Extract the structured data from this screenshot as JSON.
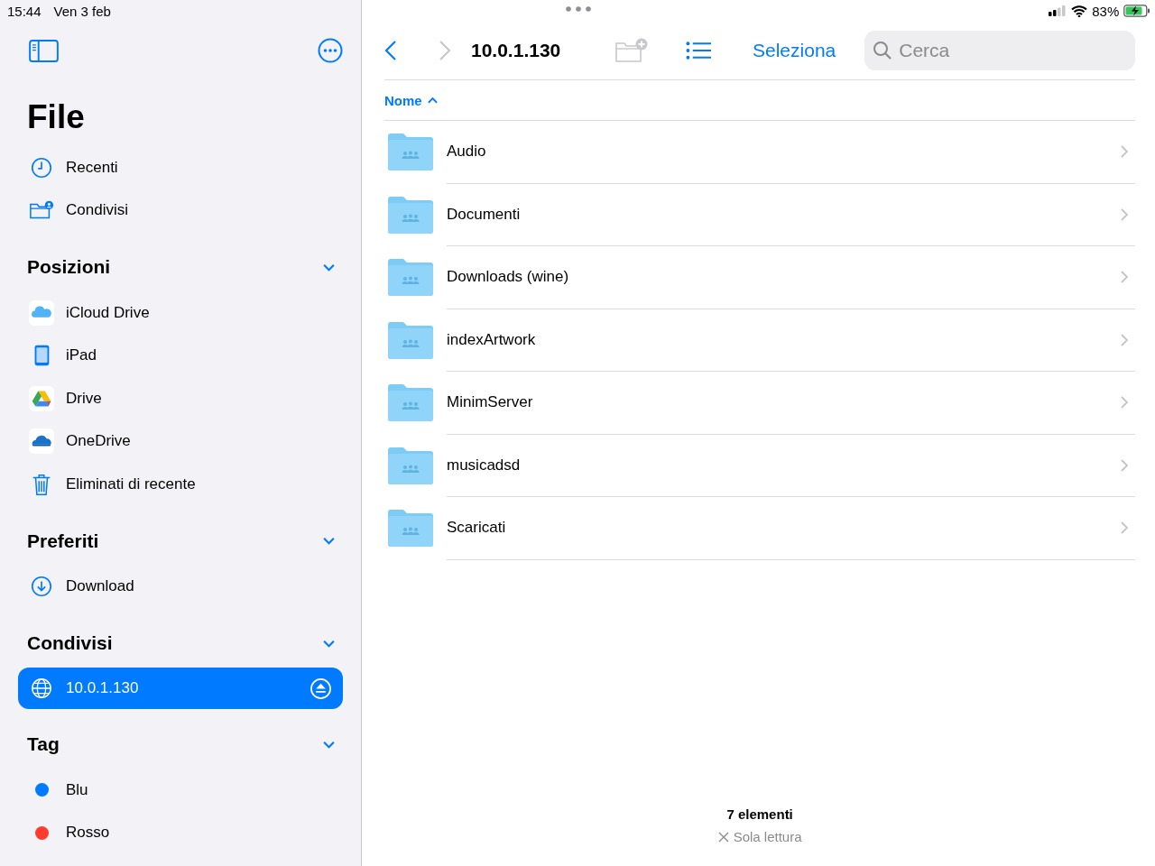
{
  "status_bar": {
    "time": "15:44",
    "date": "Ven 3 feb",
    "battery": "83%"
  },
  "sidebar": {
    "title": "File",
    "items": [
      {
        "kind": "recent",
        "label": "Recenti",
        "selected": false
      },
      {
        "kind": "shared",
        "label": "Condivisi",
        "selected": false
      }
    ],
    "sections": [
      {
        "title": "Posizioni",
        "expanded": true,
        "items": [
          {
            "kind": "icloud",
            "label": "iCloud Drive",
            "selected": false
          },
          {
            "kind": "ipad",
            "label": "iPad",
            "selected": false
          },
          {
            "kind": "gdrive",
            "label": "Drive",
            "selected": false
          },
          {
            "kind": "onedrive",
            "label": "OneDrive",
            "selected": false
          },
          {
            "kind": "trash",
            "label": "Eliminati di recente",
            "selected": false
          }
        ]
      },
      {
        "title": "Preferiti",
        "expanded": true,
        "items": [
          {
            "kind": "download",
            "label": "Download",
            "selected": false
          }
        ]
      },
      {
        "title": "Condivisi",
        "expanded": true,
        "items": [
          {
            "kind": "server",
            "label": "10.0.1.130",
            "selected": true
          }
        ]
      },
      {
        "title": "Tag",
        "expanded": true,
        "items": [
          {
            "kind": "tag",
            "label": "Blu",
            "color": "#007aff",
            "selected": false
          },
          {
            "kind": "tag",
            "label": "Rosso",
            "color": "#ff3b30",
            "selected": false
          }
        ]
      }
    ]
  },
  "toolbar": {
    "back_disabled": false,
    "forward_disabled": true,
    "title": "10.0.1.130",
    "new_folder_disabled": true,
    "select_label": "Seleziona",
    "search": {
      "placeholder": "Cerca"
    }
  },
  "sort": {
    "label": "Nome",
    "ascending": true
  },
  "folders": [
    {
      "name": "Audio"
    },
    {
      "name": "Documenti"
    },
    {
      "name": "Downloads (wine)"
    },
    {
      "name": "indexArtwork"
    },
    {
      "name": "MinimServer"
    },
    {
      "name": "musicadsd"
    },
    {
      "name": "Scaricati"
    }
  ],
  "footer": {
    "count": "7 elementi",
    "status": "Sola lettura"
  }
}
